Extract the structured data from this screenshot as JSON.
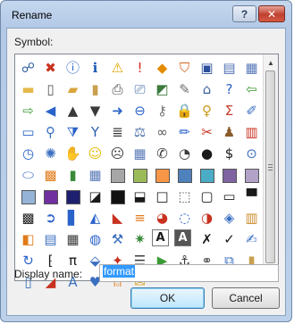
{
  "dialog": {
    "title": "Rename",
    "help_label": "?",
    "close_label": "✕"
  },
  "symbol_label": "Symbol:",
  "icons": [
    {
      "name": "org-chart-icon",
      "glyph": "☍",
      "color": "#2c5d9c"
    },
    {
      "name": "error-icon",
      "glyph": "✖",
      "color": "#c8311f"
    },
    {
      "name": "info-icon",
      "glyph": "ⓘ",
      "color": "#2a63c9"
    },
    {
      "name": "info-circle-icon",
      "glyph": "ℹ",
      "color": "#1b57b8"
    },
    {
      "name": "warning-icon",
      "glyph": "⚠",
      "color": "#e3a000"
    },
    {
      "name": "exclamation-icon",
      "glyph": "!",
      "color": "#d8261c"
    },
    {
      "name": "diamond-alert-icon",
      "glyph": "◆",
      "color": "#e38b00"
    },
    {
      "name": "shield-icon",
      "glyph": "⛉",
      "color": "#d4621b"
    },
    {
      "name": "save-icon",
      "glyph": "▣",
      "color": "#2b4f9c"
    },
    {
      "name": "save-all-icon",
      "glyph": "▤",
      "color": "#4f6fb3"
    },
    {
      "name": "multi-save-icon",
      "glyph": "▦",
      "color": "#5a7ab8"
    },
    {
      "name": "folder-icon",
      "glyph": "▬",
      "color": "#e5b84a"
    },
    {
      "name": "new-document-icon",
      "glyph": "▯",
      "color": "#555555"
    },
    {
      "name": "open-folder-icon",
      "glyph": "▰",
      "color": "#d9a53c"
    },
    {
      "name": "paste-icon",
      "glyph": "▮",
      "color": "#c9a04d"
    },
    {
      "name": "print-icon",
      "glyph": "⎙",
      "color": "#444444"
    },
    {
      "name": "print-preview-icon",
      "glyph": "⎚",
      "color": "#4a6fa5"
    },
    {
      "name": "image-icon",
      "glyph": "◩",
      "color": "#3d7a3d"
    },
    {
      "name": "edit-document-icon",
      "glyph": "✎",
      "color": "#6b6b6b"
    },
    {
      "name": "home-icon",
      "glyph": "⌂",
      "color": "#3a5fa0"
    },
    {
      "name": "help-icon",
      "glyph": "?",
      "color": "#2a63c9"
    },
    {
      "name": "back-arrow-icon",
      "glyph": "⇦",
      "color": "#3f9a35"
    },
    {
      "name": "forward-arrow-icon",
      "glyph": "⇨",
      "color": "#3f9a35"
    },
    {
      "name": "left-arrow-icon",
      "glyph": "◀",
      "color": "#2a63c9"
    },
    {
      "name": "triangle-up-icon",
      "glyph": "▲",
      "color": "#3a3a3a"
    },
    {
      "name": "triangle-down-icon",
      "glyph": "▼",
      "color": "#3a3a3a"
    },
    {
      "name": "up-arrow-circle-icon",
      "glyph": "➜",
      "color": "#2a63c9"
    },
    {
      "name": "left-arrow-circle-icon",
      "glyph": "⊖",
      "color": "#2a63c9"
    },
    {
      "name": "key-icon",
      "glyph": "⚷",
      "color": "#777777"
    },
    {
      "name": "lock-icon",
      "glyph": "🔒",
      "color": "#d6a21e"
    },
    {
      "name": "key-gold-icon",
      "glyph": "♀",
      "color": "#c99a1e"
    },
    {
      "name": "sum-icon",
      "glyph": "Σ",
      "color": "#c23a2a"
    },
    {
      "name": "pencil-icon",
      "glyph": "✐",
      "color": "#3a6fc0"
    },
    {
      "name": "window-icon",
      "glyph": "▭",
      "color": "#2a63c9"
    },
    {
      "name": "search-icon",
      "glyph": "⚲",
      "color": "#3a6fc0"
    },
    {
      "name": "filter-icon",
      "glyph": "⧩",
      "color": "#2a63c9"
    },
    {
      "name": "funnel-icon",
      "glyph": "Y",
      "color": "#2a5fb0"
    },
    {
      "name": "document-list-icon",
      "glyph": "≣",
      "color": "#3a3a3a"
    },
    {
      "name": "scales-icon",
      "glyph": "⚖",
      "color": "#4a6fa5"
    },
    {
      "name": "link-icon",
      "glyph": "∞",
      "color": "#555555"
    },
    {
      "name": "edit-icon",
      "glyph": "✏",
      "color": "#2a63c9"
    },
    {
      "name": "cut-icon",
      "glyph": "✂",
      "color": "#c8311f"
    },
    {
      "name": "user-icon",
      "glyph": "♟",
      "color": "#8a5a2a"
    },
    {
      "name": "calendar-icon",
      "glyph": "▥",
      "color": "#c8311f"
    },
    {
      "name": "clock-icon",
      "glyph": "◷",
      "color": "#2a63c9"
    },
    {
      "name": "sparkle-icon",
      "glyph": "✺",
      "color": "#3a6fc0"
    },
    {
      "name": "hand-icon",
      "glyph": "✋",
      "color": "#c98a4a"
    },
    {
      "name": "smiley-icon",
      "glyph": "☺",
      "color": "#e6b800"
    },
    {
      "name": "sad-face-icon",
      "glyph": "☹",
      "color": "#3a3a3a"
    },
    {
      "name": "table-icon",
      "glyph": "▦",
      "color": "#5a7ab8"
    },
    {
      "name": "phone-icon",
      "glyph": "✆",
      "color": "#3a3a3a"
    },
    {
      "name": "pie-chart-icon",
      "glyph": "◔",
      "color": "#3a3a3a"
    },
    {
      "name": "disc-icon",
      "glyph": "●",
      "color": "#1a1a1a"
    },
    {
      "name": "dollar-icon",
      "glyph": "$",
      "color": "#1a1a1a"
    },
    {
      "name": "eye-icon",
      "glyph": "⊙",
      "color": "#3a6fc0"
    },
    {
      "name": "lens-icon",
      "glyph": "⬭",
      "color": "#3a6fc0"
    },
    {
      "name": "color-grid-icon",
      "glyph": "▩",
      "color": "#e07b1a"
    },
    {
      "name": "bar-chart-icon",
      "glyph": "▮",
      "color": "#3a8a3a"
    },
    {
      "name": "chart-grid-icon",
      "glyph": "▦",
      "color": "#5a7ab8"
    },
    {
      "name": "gray-swatch-icon",
      "swatch": "#a6a6a6"
    },
    {
      "name": "green-swatch-icon",
      "swatch": "#9bbb59"
    },
    {
      "name": "orange-swatch-icon",
      "swatch": "#f79646"
    },
    {
      "name": "blue-swatch-icon",
      "swatch": "#4f81bd"
    },
    {
      "name": "teal-swatch-icon",
      "swatch": "#4bacc6"
    },
    {
      "name": "purple-swatch-icon",
      "swatch": "#8064a2"
    },
    {
      "name": "lavender-swatch-icon",
      "swatch": "#b3a2c7"
    },
    {
      "name": "light-blue-swatch-icon",
      "swatch": "#95b3d7"
    },
    {
      "name": "violet-swatch-icon",
      "swatch": "#7030a0"
    },
    {
      "name": "navy-swatch-icon",
      "swatch": "#1f1f6f"
    },
    {
      "name": "split-swatch-icon",
      "glyph": "◪",
      "color": "#1a1a1a"
    },
    {
      "name": "black-swatch-icon",
      "swatch": "#111111"
    },
    {
      "name": "half-box-icon",
      "glyph": "⬓",
      "color": "#1a1a1a"
    },
    {
      "name": "outline-box-icon",
      "glyph": "□",
      "color": "#1a1a1a"
    },
    {
      "name": "dotted-box-icon",
      "glyph": "⬚",
      "color": "#555555"
    },
    {
      "name": "empty-box-icon",
      "glyph": "▢",
      "color": "#1a1a1a"
    },
    {
      "name": "bar-box-icon",
      "glyph": "▭",
      "color": "#1a1a1a"
    },
    {
      "name": "header-box-icon",
      "glyph": "▀",
      "color": "#1a1a1a"
    },
    {
      "name": "checker-icon",
      "glyph": "▩",
      "color": "#1a1a1a"
    },
    {
      "name": "arrow-circle-icon",
      "glyph": "➲",
      "color": "#2a63c9"
    },
    {
      "name": "column-chart-icon",
      "glyph": "▋",
      "color": "#2a63c9"
    },
    {
      "name": "drop-icon",
      "glyph": "◭",
      "color": "#2a63c9"
    },
    {
      "name": "mountain-chart-icon",
      "glyph": "◣",
      "color": "#c8311f"
    },
    {
      "name": "layers-icon",
      "glyph": "≡",
      "color": "#e07b1a"
    },
    {
      "name": "donut-chart-icon",
      "glyph": "◕",
      "color": "#c8311f"
    },
    {
      "name": "ring-chart-icon",
      "glyph": "◌",
      "color": "#2a63c9"
    },
    {
      "name": "piechart-icon",
      "glyph": "◑",
      "color": "#c8311f"
    },
    {
      "name": "stack-icon",
      "glyph": "◈",
      "color": "#3a6fc0"
    },
    {
      "name": "book-icon",
      "glyph": "▥",
      "color": "#c98a2a"
    },
    {
      "name": "cube-icon",
      "glyph": "◧",
      "color": "#e07b1a"
    },
    {
      "name": "form-icon",
      "glyph": "▤",
      "color": "#3a6fc0"
    },
    {
      "name": "calendar-grid-icon",
      "glyph": "▦",
      "color": "#3a3a3a"
    },
    {
      "name": "globe-icon",
      "glyph": "◍",
      "color": "#2a63c9"
    },
    {
      "name": "wrench-icon",
      "glyph": "⚒",
      "color": "#3a6fc0"
    },
    {
      "name": "star-burst-icon",
      "glyph": "✷",
      "color": "#3a8a3a"
    },
    {
      "name": "text-a-icon",
      "glyph": "A",
      "color": "#1a1a1a"
    },
    {
      "name": "bold-a-icon",
      "glyph": "A",
      "color": "#1a1a1a"
    },
    {
      "name": "x-mark-icon",
      "glyph": "✗",
      "color": "#1a1a1a"
    },
    {
      "name": "checkmark-icon",
      "glyph": "✓",
      "color": "#1a1a1a"
    },
    {
      "name": "chart-edit-icon",
      "glyph": "✍",
      "color": "#3a6fc0"
    },
    {
      "name": "refresh-icon",
      "glyph": "↻",
      "color": "#2a63c9"
    },
    {
      "name": "bracket-icon",
      "glyph": "⁅",
      "color": "#1a1a1a"
    },
    {
      "name": "pi-icon",
      "glyph": "π",
      "color": "#1a1a1a"
    },
    {
      "name": "paint-bucket-icon",
      "glyph": "⬙",
      "color": "#3a6fc0"
    },
    {
      "name": "wand-icon",
      "glyph": "✦",
      "color": "#c8311f"
    },
    {
      "name": "list-icon",
      "glyph": "☰",
      "color": "#3a3a3a"
    },
    {
      "name": "play-icon",
      "glyph": "▶",
      "color": "#3a9a35"
    },
    {
      "name": "anchor-icon",
      "glyph": "⚓",
      "color": "#3a3a3a"
    },
    {
      "name": "binoculars-icon",
      "glyph": "⚭",
      "color": "#555555"
    },
    {
      "name": "document-stack-icon",
      "glyph": "⧉",
      "color": "#3a6fc0"
    },
    {
      "name": "clipboard-icon",
      "glyph": "▮",
      "color": "#c9a04d"
    },
    {
      "name": "page-icon",
      "glyph": "▯",
      "color": "#3a6fc0"
    },
    {
      "name": "eraser-icon",
      "glyph": "◢",
      "color": "#c8311f"
    },
    {
      "name": "font-color-icon",
      "glyph": "A",
      "color": "#3a6fc0"
    },
    {
      "name": "heart-icon",
      "glyph": "♥",
      "color": "#3a6fc0"
    },
    {
      "name": "warning-bell-icon",
      "glyph": "⍝",
      "color": "#e07b1a"
    },
    {
      "name": "mail-icon",
      "glyph": "✉",
      "color": "#d6a21e"
    }
  ],
  "display_name": {
    "label": "Display name:",
    "value": "format"
  },
  "buttons": {
    "ok": "OK",
    "cancel": "Cancel"
  }
}
